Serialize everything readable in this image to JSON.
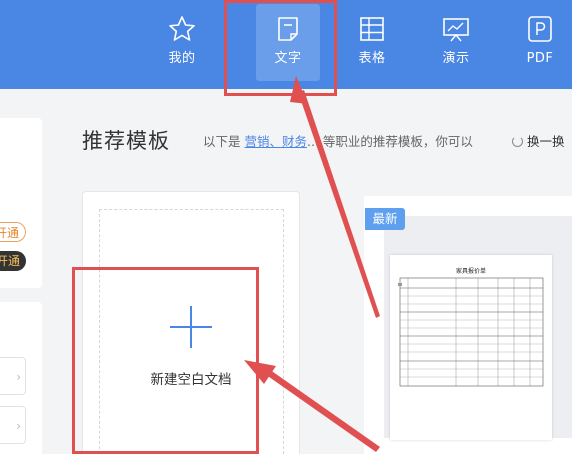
{
  "nav": {
    "tabs": [
      {
        "label": "我的",
        "icon": "star-icon"
      },
      {
        "label": "文字",
        "icon": "document-icon",
        "active": true
      },
      {
        "label": "表格",
        "icon": "table-icon"
      },
      {
        "label": "演示",
        "icon": "presentation-icon"
      },
      {
        "label": "PDF",
        "icon": "pdf-icon"
      }
    ]
  },
  "sidebar": {
    "pill_outline": "开通",
    "pill_dark": "开通"
  },
  "main": {
    "title": "推荐模板",
    "subtitle_prefix": "以下是",
    "subtitle_links": "营销、财务",
    "subtitle_suffix": "... 等职业的推荐模板，你可以",
    "refresh_label": "换一换"
  },
  "blank_doc": {
    "label": "新建空白文档"
  },
  "template": {
    "badge": "最新",
    "doc_title": "家具报价单"
  },
  "colors": {
    "topbar": "#4a86e4",
    "accent": "#4a86e4",
    "annotation": "#e05050"
  }
}
